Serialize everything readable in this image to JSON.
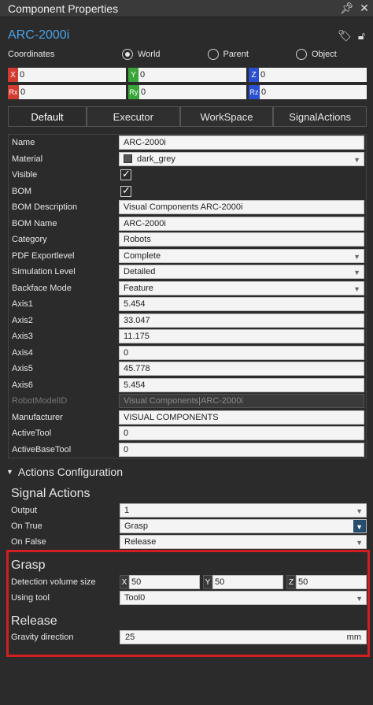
{
  "window": {
    "title": "Component Properties"
  },
  "component": {
    "name": "ARC-2000i"
  },
  "coordinates": {
    "label": "Coordinates",
    "options": [
      "World",
      "Parent",
      "Object"
    ],
    "selected": "World",
    "position": [
      {
        "tag": "X",
        "value": "0",
        "color": "#d23b2f"
      },
      {
        "tag": "Y",
        "value": "0",
        "color": "#3aa63a"
      },
      {
        "tag": "Z",
        "value": "0",
        "color": "#2a4fd0"
      }
    ],
    "rotation": [
      {
        "tag": "Rx",
        "value": "0",
        "color": "#d23b2f"
      },
      {
        "tag": "Ry",
        "value": "0",
        "color": "#3aa63a"
      },
      {
        "tag": "Rz",
        "value": "0",
        "color": "#2a4fd0"
      }
    ]
  },
  "tabs": [
    "Default",
    "Executor",
    "WorkSpace",
    "SignalActions"
  ],
  "properties": [
    {
      "label": "Name",
      "value": "ARC-2000i",
      "kind": "text"
    },
    {
      "label": "Material",
      "value": "dark_grey",
      "kind": "dropdown-swatch"
    },
    {
      "label": "Visible",
      "value": "",
      "kind": "check"
    },
    {
      "label": "BOM",
      "value": "",
      "kind": "check"
    },
    {
      "label": "BOM Description",
      "value": "Visual Components ARC-2000i",
      "kind": "text"
    },
    {
      "label": "BOM Name",
      "value": "ARC-2000i",
      "kind": "text"
    },
    {
      "label": "Category",
      "value": "Robots",
      "kind": "text"
    },
    {
      "label": "PDF Exportlevel",
      "value": "Complete",
      "kind": "dropdown"
    },
    {
      "label": "Simulation Level",
      "value": "Detailed",
      "kind": "dropdown"
    },
    {
      "label": "Backface Mode",
      "value": "Feature",
      "kind": "dropdown"
    },
    {
      "label": "Axis1",
      "value": "5.454",
      "kind": "text"
    },
    {
      "label": "Axis2",
      "value": "33.047",
      "kind": "text"
    },
    {
      "label": "Axis3",
      "value": "11.175",
      "kind": "text"
    },
    {
      "label": "Axis4",
      "value": "0",
      "kind": "text"
    },
    {
      "label": "Axis5",
      "value": "45.778",
      "kind": "text"
    },
    {
      "label": "Axis6",
      "value": "5.454",
      "kind": "text"
    },
    {
      "label": "RobotModelID",
      "value": "Visual Components|ARC-2000i",
      "kind": "disabled"
    },
    {
      "label": "Manufacturer",
      "value": "VISUAL COMPONENTS",
      "kind": "text"
    },
    {
      "label": "ActiveTool",
      "value": "0",
      "kind": "text"
    },
    {
      "label": "ActiveBaseTool",
      "value": "0",
      "kind": "text"
    }
  ],
  "actions": {
    "section_title": "Actions Configuration",
    "signal_title": "Signal Actions",
    "output": {
      "label": "Output",
      "value": "1"
    },
    "on_true": {
      "label": "On True",
      "value": "Grasp"
    },
    "on_false": {
      "label": "On False",
      "value": "Release"
    },
    "grasp": {
      "title": "Grasp",
      "detection_label": "Detection volume size",
      "x": "50",
      "y": "50",
      "z": "50",
      "tool_label": "Using tool",
      "tool_value": "Tool0"
    },
    "release": {
      "title": "Release",
      "gravity_label": "Gravity direction",
      "gravity_value": "25",
      "unit": "mm"
    }
  }
}
